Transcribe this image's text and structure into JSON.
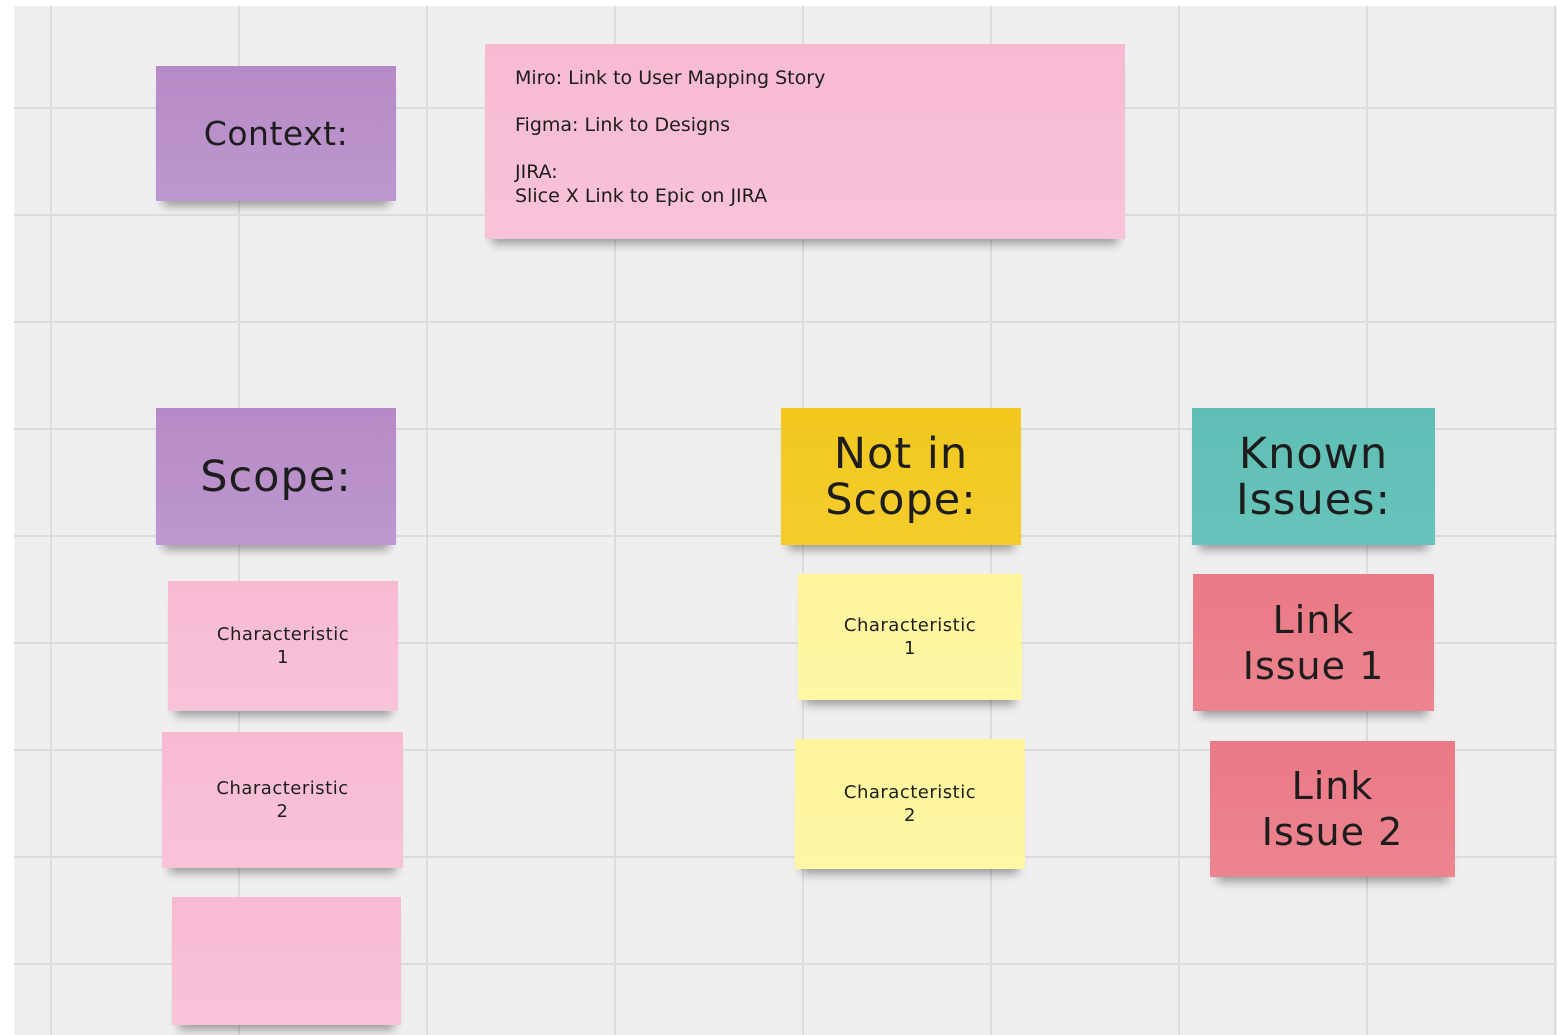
{
  "board": {
    "context_title": "Context:",
    "context_links": {
      "miro": "Miro: Link to User Mapping Story",
      "figma": "Figma: Link to Designs",
      "jira": "JIRA:\nSlice X Link to Epic on JIRA"
    },
    "scope": {
      "title": "Scope:",
      "items": [
        "Characteristic\n1",
        "Characteristic\n2",
        ""
      ]
    },
    "not_in_scope": {
      "title": "Not in\nScope:",
      "items": [
        "Characteristic\n1",
        "Characteristic\n2"
      ]
    },
    "known_issues": {
      "title": "Known\nIssues:",
      "items": [
        "Link\nIssue 1",
        "Link\nIssue 2"
      ]
    }
  },
  "colors": {
    "canvas": "#efefef",
    "grid_line": "#dcdcdc",
    "purple_note": "#bb92cc",
    "pink_note": "#f7bed5",
    "yellow_note": "#fdf5a0",
    "gold_note": "#f3ca25",
    "teal_note": "#63c1b7",
    "rose_note": "#eb7f8a"
  }
}
